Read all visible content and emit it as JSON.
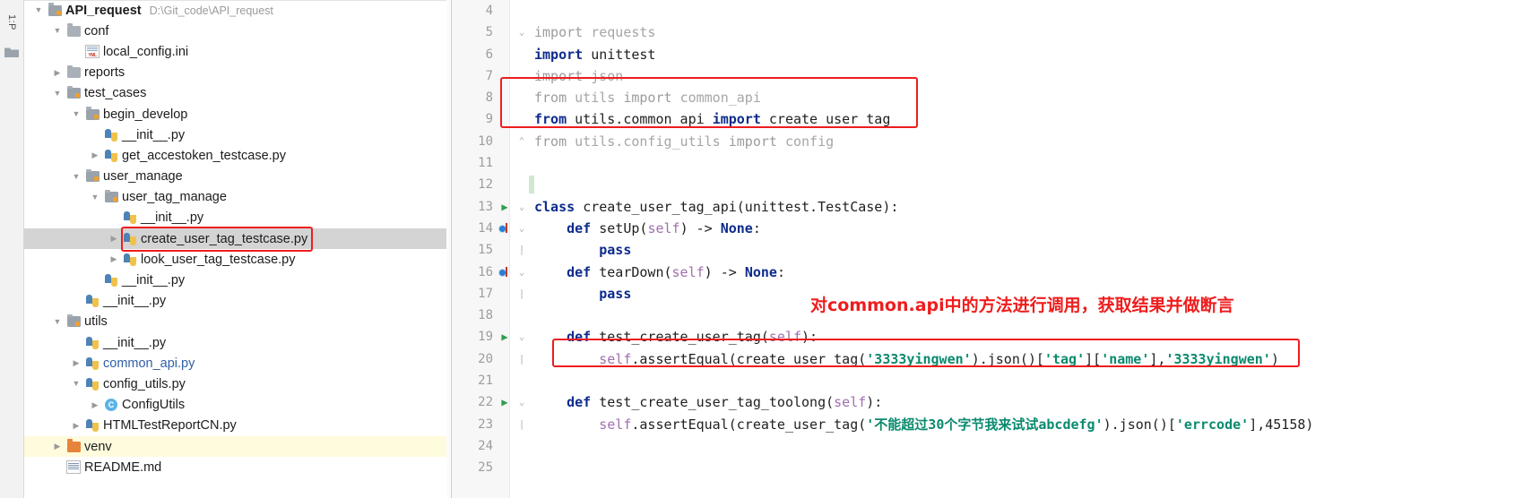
{
  "toolstrip": {
    "vertical_tab_label": "1:P",
    "folder_icon": "folder-icon"
  },
  "project_tree": {
    "nodes": [
      {
        "indent": 0,
        "twisty": "down",
        "icon": "source-folder-icon",
        "label": "API_request",
        "bold": true,
        "hint": "D:\\Git_code\\API_request",
        "selected": false
      },
      {
        "indent": 1,
        "twisty": "down",
        "icon": "folder-icon",
        "label": "conf",
        "bold": false,
        "hint": "",
        "selected": false
      },
      {
        "indent": 2,
        "twisty": "none",
        "icon": "ini-file-icon",
        "label": "local_config.ini",
        "bold": false,
        "hint": "",
        "selected": false
      },
      {
        "indent": 1,
        "twisty": "right",
        "icon": "folder-icon",
        "label": "reports",
        "bold": false,
        "hint": "",
        "selected": false
      },
      {
        "indent": 1,
        "twisty": "down",
        "icon": "source-folder-icon",
        "label": "test_cases",
        "bold": false,
        "hint": "",
        "selected": false
      },
      {
        "indent": 2,
        "twisty": "down",
        "icon": "source-folder-icon",
        "label": "begin_develop",
        "bold": false,
        "hint": "",
        "selected": false
      },
      {
        "indent": 3,
        "twisty": "none",
        "icon": "python-file-icon",
        "label": "__init__.py",
        "bold": false,
        "hint": "",
        "selected": false
      },
      {
        "indent": 3,
        "twisty": "right",
        "icon": "python-file-icon",
        "label": "get_accestoken_testcase.py",
        "bold": false,
        "hint": "",
        "selected": false
      },
      {
        "indent": 2,
        "twisty": "down",
        "icon": "source-folder-icon",
        "label": "user_manage",
        "bold": false,
        "hint": "",
        "selected": false
      },
      {
        "indent": 3,
        "twisty": "down",
        "icon": "source-folder-icon",
        "label": "user_tag_manage",
        "bold": false,
        "hint": "",
        "selected": false
      },
      {
        "indent": 4,
        "twisty": "none",
        "icon": "python-file-icon",
        "label": "__init__.py",
        "bold": false,
        "hint": "",
        "selected": false
      },
      {
        "indent": 4,
        "twisty": "right",
        "icon": "python-file-icon",
        "label": "create_user_tag_testcase.py",
        "bold": false,
        "hint": "",
        "selected": true,
        "highlighted": true
      },
      {
        "indent": 4,
        "twisty": "right",
        "icon": "python-file-icon",
        "label": "look_user_tag_testcase.py",
        "bold": false,
        "hint": "",
        "selected": false
      },
      {
        "indent": 3,
        "twisty": "none",
        "icon": "python-file-icon",
        "label": "__init__.py",
        "bold": false,
        "hint": "",
        "selected": false
      },
      {
        "indent": 2,
        "twisty": "none",
        "icon": "python-file-icon",
        "label": "__init__.py",
        "bold": false,
        "hint": "",
        "selected": false
      },
      {
        "indent": 1,
        "twisty": "down",
        "icon": "source-folder-icon",
        "label": "utils",
        "bold": false,
        "hint": "",
        "selected": false
      },
      {
        "indent": 2,
        "twisty": "none",
        "icon": "python-file-icon",
        "label": "__init__.py",
        "bold": false,
        "hint": "",
        "selected": false
      },
      {
        "indent": 2,
        "twisty": "right",
        "icon": "python-file-icon",
        "label": "common_api.py",
        "bold": false,
        "hint": "",
        "selected": false,
        "blue": true
      },
      {
        "indent": 2,
        "twisty": "down",
        "icon": "python-file-icon",
        "label": "config_utils.py",
        "bold": false,
        "hint": "",
        "selected": false
      },
      {
        "indent": 3,
        "twisty": "right",
        "icon": "class-icon",
        "label": "ConfigUtils",
        "bold": false,
        "hint": "",
        "selected": false
      },
      {
        "indent": 2,
        "twisty": "right",
        "icon": "python-file-icon",
        "label": "HTMLTestReportCN.py",
        "bold": false,
        "hint": "",
        "selected": false
      },
      {
        "indent": 1,
        "twisty": "right",
        "icon": "excluded-folder-icon",
        "label": "venv",
        "bold": false,
        "hint": "",
        "selected": false,
        "venv": true
      },
      {
        "indent": 1,
        "twisty": "none",
        "icon": "markdown-file-icon",
        "label": "README.md",
        "bold": false,
        "hint": "",
        "selected": false
      }
    ]
  },
  "editor": {
    "lines": [
      {
        "num": "4",
        "mark": "none",
        "fold": "",
        "tokens": []
      },
      {
        "num": "5",
        "mark": "none",
        "fold": "v",
        "tokens": [
          {
            "t": "import ",
            "c": "kw-dim"
          },
          {
            "t": "requests",
            "c": "txt-dim"
          }
        ]
      },
      {
        "num": "6",
        "mark": "none",
        "fold": "",
        "tokens": [
          {
            "t": "import ",
            "c": "kw"
          },
          {
            "t": "unittest",
            "c": "txt"
          }
        ]
      },
      {
        "num": "7",
        "mark": "none",
        "fold": "",
        "tokens": [
          {
            "t": "import ",
            "c": "kw-dim"
          },
          {
            "t": "json",
            "c": "txt-dim"
          }
        ]
      },
      {
        "num": "8",
        "mark": "none",
        "fold": "",
        "tokens": [
          {
            "t": "from ",
            "c": "kw-dim"
          },
          {
            "t": "utils ",
            "c": "txt-dim"
          },
          {
            "t": "import ",
            "c": "kw-dim"
          },
          {
            "t": "common_api",
            "c": "txt-dim"
          }
        ]
      },
      {
        "num": "9",
        "mark": "none",
        "fold": "",
        "tokens": [
          {
            "t": "from ",
            "c": "kw"
          },
          {
            "t": "utils.common_api ",
            "c": "txt"
          },
          {
            "t": "import ",
            "c": "kw"
          },
          {
            "t": "create_user_tag",
            "c": "txt"
          }
        ]
      },
      {
        "num": "10",
        "mark": "none",
        "fold": "^",
        "tokens": [
          {
            "t": "from ",
            "c": "kw-dim"
          },
          {
            "t": "utils.config_utils ",
            "c": "txt-dim"
          },
          {
            "t": "import ",
            "c": "kw-dim"
          },
          {
            "t": "config",
            "c": "txt-dim"
          }
        ]
      },
      {
        "num": "11",
        "mark": "none",
        "fold": "",
        "tokens": []
      },
      {
        "num": "12",
        "mark": "none",
        "fold": "",
        "tokens": []
      },
      {
        "num": "13",
        "mark": "run",
        "fold": "v",
        "tokens": [
          {
            "t": "class ",
            "c": "kw"
          },
          {
            "t": "create_user_tag_api(unittest.TestCase):",
            "c": "txt"
          }
        ]
      },
      {
        "num": "14",
        "mark": "over",
        "fold": "v",
        "tokens": [
          {
            "t": "    def ",
            "c": "kw"
          },
          {
            "t": "setUp(",
            "c": "txt"
          },
          {
            "t": "self",
            "c": "self"
          },
          {
            "t": ") -> ",
            "c": "txt"
          },
          {
            "t": "None",
            "c": "kw"
          },
          {
            "t": ":",
            "c": "txt"
          }
        ]
      },
      {
        "num": "15",
        "mark": "none",
        "fold": "-",
        "tokens": [
          {
            "t": "        pass",
            "c": "kw"
          }
        ]
      },
      {
        "num": "16",
        "mark": "over",
        "fold": "v",
        "tokens": [
          {
            "t": "    def ",
            "c": "kw"
          },
          {
            "t": "tearDown(",
            "c": "txt"
          },
          {
            "t": "self",
            "c": "self"
          },
          {
            "t": ") -> ",
            "c": "txt"
          },
          {
            "t": "None",
            "c": "kw"
          },
          {
            "t": ":",
            "c": "txt"
          }
        ]
      },
      {
        "num": "17",
        "mark": "none",
        "fold": "-",
        "tokens": [
          {
            "t": "        pass",
            "c": "kw"
          }
        ]
      },
      {
        "num": "18",
        "mark": "none",
        "fold": "",
        "tokens": []
      },
      {
        "num": "19",
        "mark": "run",
        "fold": "v",
        "tokens": [
          {
            "t": "    def ",
            "c": "kw"
          },
          {
            "t": "test_create_user_tag(",
            "c": "txt"
          },
          {
            "t": "self",
            "c": "self"
          },
          {
            "t": "):",
            "c": "txt"
          }
        ]
      },
      {
        "num": "20",
        "mark": "none",
        "fold": "-",
        "tokens": [
          {
            "t": "        ",
            "c": "txt"
          },
          {
            "t": "self",
            "c": "self"
          },
          {
            "t": ".assertEqual(create_user_tag(",
            "c": "txt"
          },
          {
            "t": "'3333yingwen'",
            "c": "str"
          },
          {
            "t": ").json()[",
            "c": "txt"
          },
          {
            "t": "'tag'",
            "c": "str"
          },
          {
            "t": "][",
            "c": "txt"
          },
          {
            "t": "'name'",
            "c": "str"
          },
          {
            "t": "],",
            "c": "txt"
          },
          {
            "t": "'3333yingwen'",
            "c": "str"
          },
          {
            "t": ")",
            "c": "txt"
          }
        ]
      },
      {
        "num": "21",
        "mark": "none",
        "fold": "",
        "tokens": []
      },
      {
        "num": "22",
        "mark": "run",
        "fold": "v",
        "tokens": [
          {
            "t": "    def ",
            "c": "kw"
          },
          {
            "t": "test_create_user_tag_toolong(",
            "c": "txt"
          },
          {
            "t": "self",
            "c": "self"
          },
          {
            "t": "):",
            "c": "txt"
          }
        ]
      },
      {
        "num": "23",
        "mark": "none",
        "fold": "-",
        "tokens": [
          {
            "t": "        ",
            "c": "txt"
          },
          {
            "t": "self",
            "c": "self"
          },
          {
            "t": ".assertEqual(create_user_tag(",
            "c": "txt"
          },
          {
            "t": "'不能超过30个字节我来试试abcdefg'",
            "c": "str"
          },
          {
            "t": ").json()[",
            "c": "txt"
          },
          {
            "t": "'errcode'",
            "c": "str"
          },
          {
            "t": "],",
            "c": "txt"
          },
          {
            "t": "45158",
            "c": "num"
          },
          {
            "t": ")",
            "c": "txt"
          }
        ]
      },
      {
        "num": "24",
        "mark": "none",
        "fold": "",
        "tokens": []
      },
      {
        "num": "25",
        "mark": "none",
        "fold": "",
        "tokens": []
      }
    ],
    "annotation": "对common.api中的方法进行调用，获取结果并做断言",
    "highlight_color": "#ee1d1d"
  }
}
